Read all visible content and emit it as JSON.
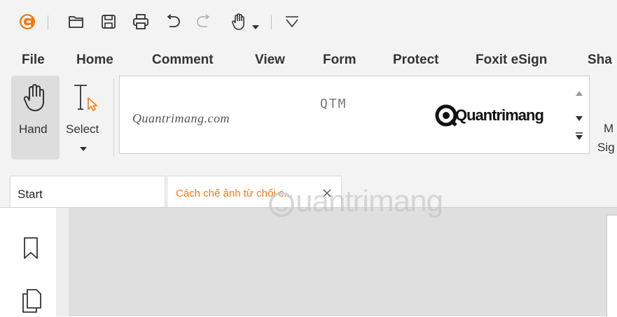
{
  "quick_access": {
    "logo": "foxit-logo",
    "icons": [
      "foxit-logo-icon",
      "open-folder-icon",
      "save-icon",
      "print-icon",
      "undo-icon",
      "redo-icon",
      "hand-tool-icon",
      "chevron-down-icon",
      "customize-dropdown-icon"
    ]
  },
  "menu": {
    "items": [
      "File",
      "Home",
      "Comment",
      "View",
      "Form",
      "Protect",
      "Foxit eSign",
      "Sha"
    ]
  },
  "ribbon": {
    "hand_label": "Hand",
    "select_label": "Select",
    "manage_label_top": "M",
    "manage_label_bottom": "Sig"
  },
  "signatures": {
    "sig1": "Quantrimang.com",
    "sig2": "QTM",
    "sig3": "Quantrimang"
  },
  "tabs": {
    "start_label": "Start",
    "doc_label": "Cách chế ảnh từ chối c..."
  },
  "watermark": {
    "text": "uantrimang"
  },
  "colors": {
    "accent": "#f07b14",
    "toolbar_bg": "#f3f3f3",
    "doc_bg": "#dfdfdf"
  }
}
